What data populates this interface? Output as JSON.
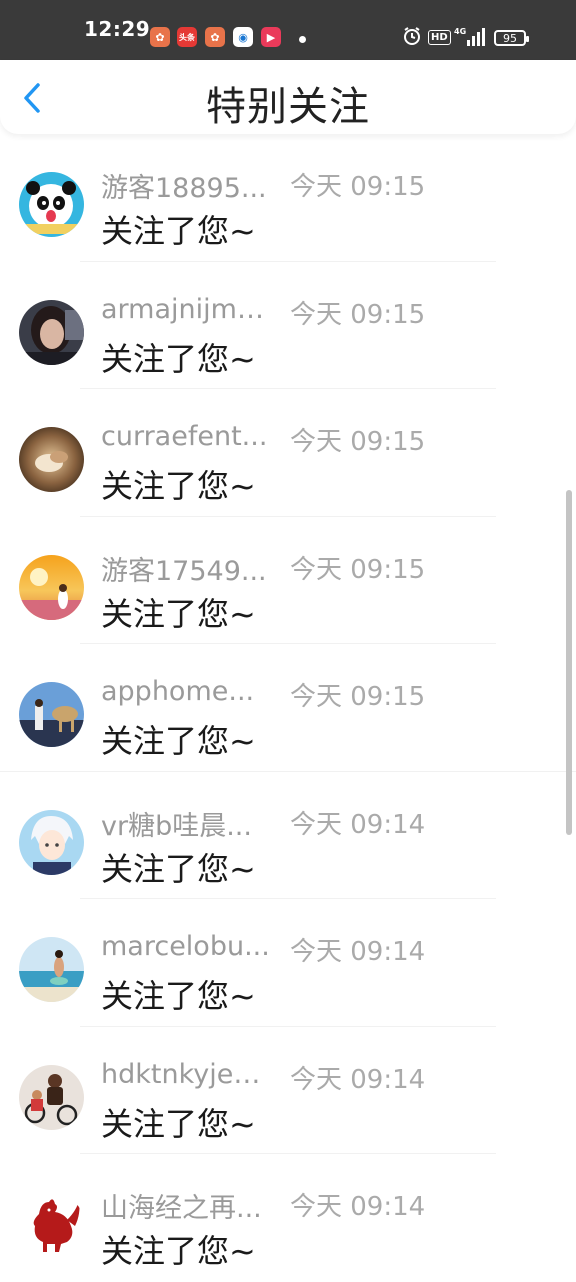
{
  "status_bar": {
    "time": "12:29",
    "battery": "95",
    "hd_label": "HD",
    "network_label": "4G"
  },
  "header": {
    "title": "特别关注"
  },
  "colors": {
    "accent": "#2196F3",
    "status_bar_bg": "#3a3a3a",
    "username": "#9a9a9a",
    "timestamp": "#aaaaaa",
    "message": "#1a1a1a"
  },
  "items": [
    {
      "username": "游客18895...",
      "time": "今天 09:15",
      "message": "关注了您~",
      "avatar": "panda"
    },
    {
      "username": "armajnijme...",
      "time": "今天 09:15",
      "message": "关注了您~",
      "avatar": "girl-dark"
    },
    {
      "username": "curraefent...",
      "time": "今天 09:15",
      "message": "关注了您~",
      "avatar": "sepia"
    },
    {
      "username": "游客17549...",
      "time": "今天 09:15",
      "message": "关注了您~",
      "avatar": "sunset"
    },
    {
      "username": "apphome...",
      "time": "今天 09:15",
      "message": "关注了您~",
      "avatar": "camel"
    },
    {
      "username": "vr糖b哇晨...",
      "time": "今天 09:14",
      "message": "关注了您~",
      "avatar": "anime"
    },
    {
      "username": "marcelobu...",
      "time": "今天 09:14",
      "message": "关注了您~",
      "avatar": "beach"
    },
    {
      "username": "hdktnkyjea...",
      "time": "今天 09:14",
      "message": "关注了您~",
      "avatar": "bikers"
    },
    {
      "username": "山海经之再...",
      "time": "今天 09:14",
      "message": "关注了您~",
      "avatar": "rooster"
    }
  ]
}
